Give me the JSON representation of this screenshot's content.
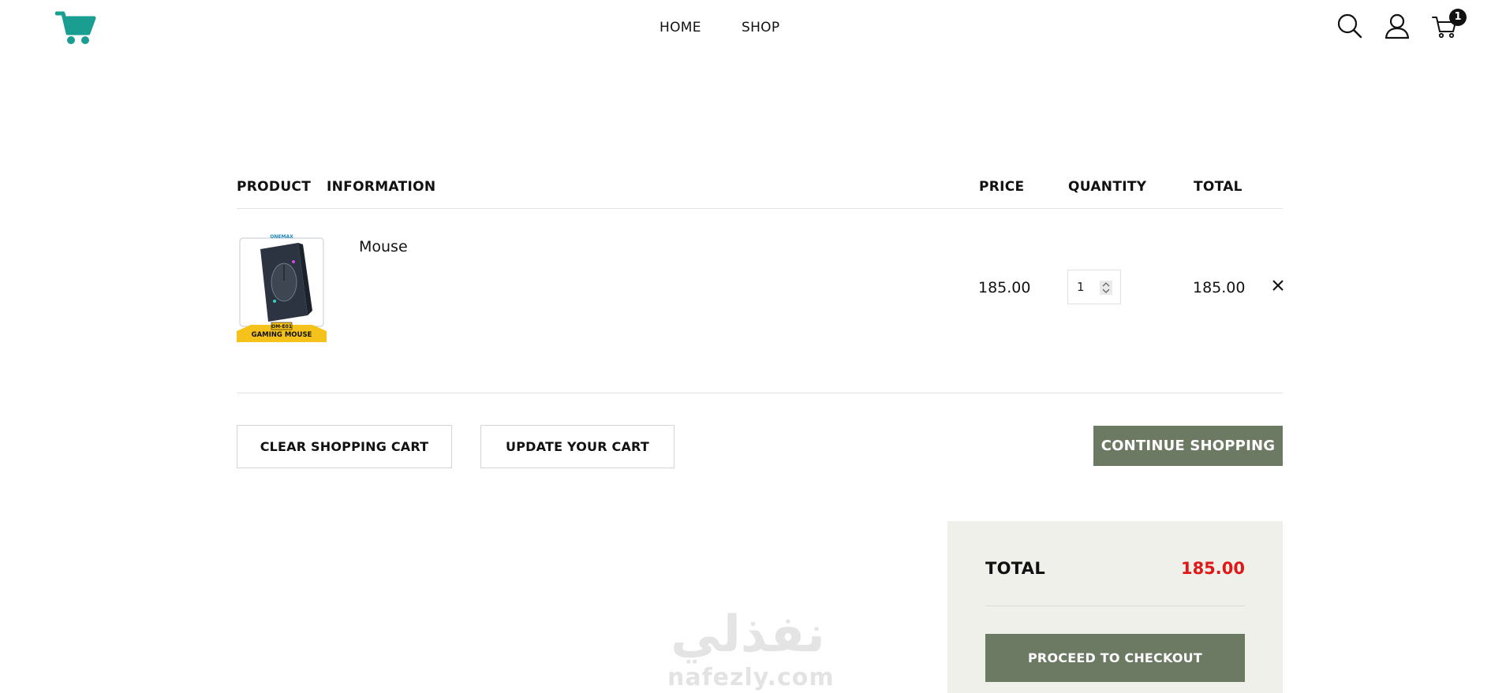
{
  "nav": {
    "home": "HOME",
    "shop": "SHOP"
  },
  "header": {
    "logo_icon": "shopping-cart-icon",
    "search_icon": "search-icon",
    "account_icon": "user-icon",
    "cart_icon": "cart-icon",
    "cart_count": "1"
  },
  "table": {
    "headers": {
      "product": "PRODUCT",
      "information": "INFORMATION",
      "price": "PRICE",
      "quantity": "QUANTITY",
      "total": "TOTAL"
    },
    "rows": [
      {
        "name": "Mouse",
        "price": "185.00",
        "quantity": "1",
        "total": "185.00",
        "image_icon": "gaming-mouse-product-image",
        "image_text": {
          "brand": "ONEMAX",
          "model": "OM-E01",
          "caption": "GAMING MOUSE"
        }
      }
    ]
  },
  "actions": {
    "clear": "CLEAR SHOPPING CART",
    "update": "UPDATE YOUR CART",
    "continue": "CONTINUE SHOPPING"
  },
  "summary": {
    "label": "TOTAL",
    "value": "185.00",
    "checkout": "PROCEED TO CHECKOUT"
  },
  "watermark": {
    "arabic": "نفذلي",
    "latin": "nafezly.com"
  },
  "colors": {
    "accent": "#1a9e91",
    "button": "#6d7a63",
    "total": "#e01818",
    "summary_bg": "#eef0e9"
  }
}
